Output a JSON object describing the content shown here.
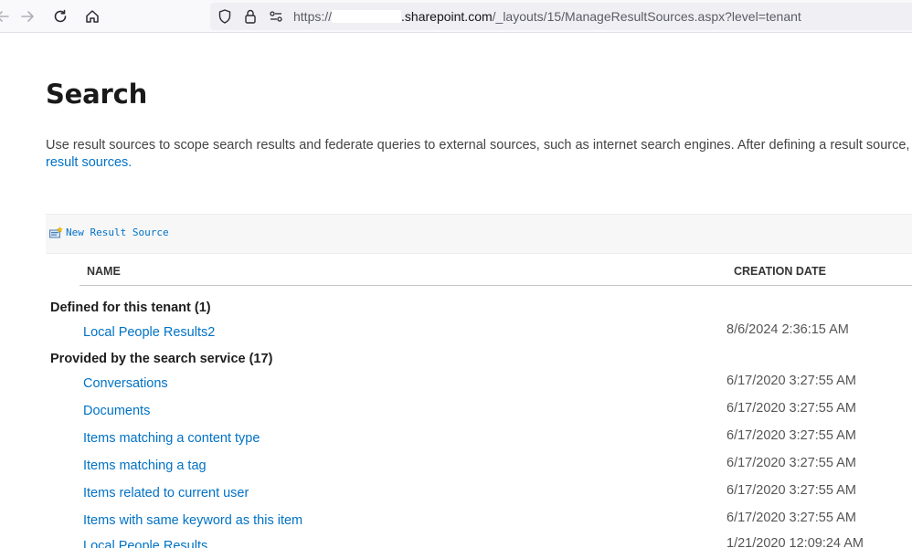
{
  "browser": {
    "url_prefix": "https://",
    "url_host": ".sharepoint.com",
    "url_path": "/_layouts/15/ManageResultSources.aspx?level=tenant"
  },
  "page": {
    "title": "Search",
    "description": "Use result sources to scope search results and federate queries to external sources, such as internet search engines. After defining a result source, configure",
    "description_link": "result sources."
  },
  "toolbar": {
    "new_result_source": "New Result Source"
  },
  "columns": {
    "name": "NAME",
    "creation_date": "CREATION DATE"
  },
  "groups": [
    {
      "label": "Defined for this tenant (1)",
      "items": [
        {
          "name": "Local People Results2",
          "date": "8/6/2024 2:36:15 AM"
        }
      ]
    },
    {
      "label": "Provided by the search service (17)",
      "items": [
        {
          "name": "Conversations",
          "date": "6/17/2020 3:27:55 AM"
        },
        {
          "name": "Documents",
          "date": "6/17/2020 3:27:55 AM"
        },
        {
          "name": "Items matching a content type",
          "date": "6/17/2020 3:27:55 AM"
        },
        {
          "name": "Items matching a tag",
          "date": "6/17/2020 3:27:55 AM"
        },
        {
          "name": "Items related to current user",
          "date": "6/17/2020 3:27:55 AM"
        },
        {
          "name": "Items with same keyword as this item",
          "date": "6/17/2020 3:27:55 AM"
        },
        {
          "name": "Local People Results",
          "date": "1/21/2020 12:09:24 AM"
        }
      ]
    }
  ],
  "icons": {
    "back": "arrow-left-icon",
    "forward": "arrow-right-icon",
    "reload": "reload-icon",
    "home": "home-icon",
    "tracking": "shield-icon",
    "lock": "lock-icon",
    "permissions": "permissions-icon",
    "new": "new-item-icon"
  },
  "colors": {
    "link": "#0072c6",
    "toolbar_bg": "#f9f9fb",
    "urlbar_bg": "#f0f0f4"
  }
}
